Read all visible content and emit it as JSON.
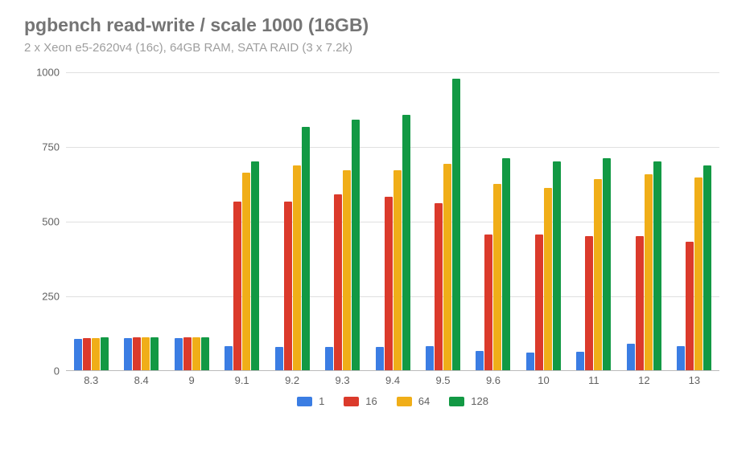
{
  "title": "pgbench read-write / scale 1000 (16GB)",
  "subtitle": "2 x Xeon e5-2620v4 (16c), 64GB RAM, SATA RAID (3 x 7.2k)",
  "chart_data": {
    "type": "bar",
    "xlabel": "",
    "ylabel": "",
    "ylim": [
      0,
      1000
    ],
    "yticks": [
      0,
      250,
      500,
      750,
      1000
    ],
    "categories": [
      "8.3",
      "8.4",
      "9",
      "9.1",
      "9.2",
      "9.3",
      "9.4",
      "9.5",
      "9.6",
      "10",
      "11",
      "12",
      "13"
    ],
    "series": [
      {
        "name": "1",
        "color": "#3b7de3",
        "values": [
          105,
          108,
          108,
          80,
          78,
          78,
          78,
          80,
          65,
          58,
          62,
          90,
          80
        ]
      },
      {
        "name": "16",
        "color": "#db3a2b",
        "values": [
          108,
          110,
          110,
          565,
          565,
          590,
          580,
          560,
          455,
          455,
          450,
          450,
          430
        ]
      },
      {
        "name": "64",
        "color": "#f0ae18",
        "values": [
          108,
          110,
          110,
          660,
          685,
          670,
          670,
          690,
          625,
          610,
          640,
          655,
          645
        ]
      },
      {
        "name": "128",
        "color": "#129944",
        "values": [
          110,
          110,
          110,
          700,
          815,
          840,
          855,
          975,
          710,
          700,
          710,
          700,
          685
        ]
      }
    ]
  }
}
